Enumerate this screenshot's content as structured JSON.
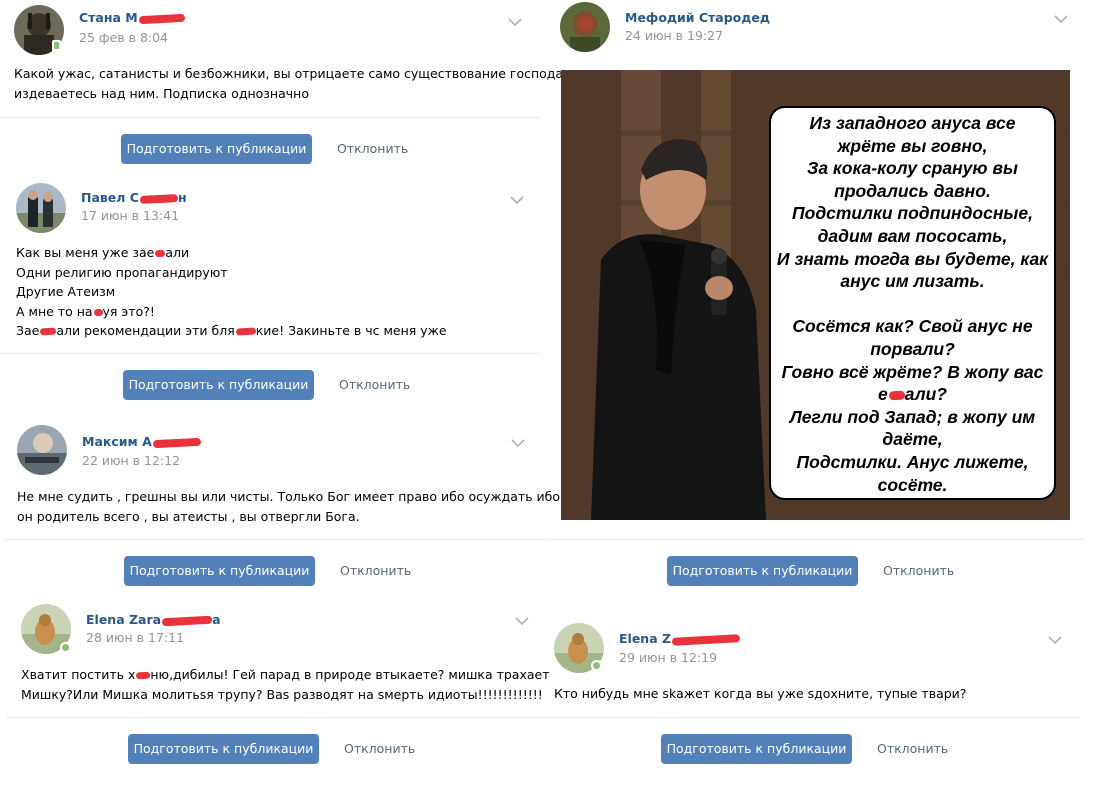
{
  "posts": [
    {
      "author": "Стана М",
      "author_suffix": "",
      "date": "25 фев в 8:04",
      "lines": [
        "Какой ужас, сатанисты и безбожники, вы отрицаете само существование господа,",
        "издеваетесь над ним. Подписка однозначно"
      ]
    },
    {
      "author": "Павел С",
      "author_suffix": "н",
      "date": "17 июн в 13:41",
      "lines": [
        "Как вы меня уже зае|али",
        "Одни религию пропагандируют",
        "Другие Атеизм",
        "А мне то на|уя это?!",
        "Зае|али рекомендации эти бля|кие! Закиньте в чс меня уже"
      ]
    },
    {
      "author": "Максим А",
      "author_suffix": "",
      "date": "22 июн в 12:12",
      "lines": [
        "Не мне судить , грешны вы или чисты. Только Бог имеет право ибо осуждать ибо",
        "он родитель всего , вы атеисты , вы отвергли Бога."
      ]
    },
    {
      "author": "Elena Zara",
      "author_suffix": "a",
      "date": "28 июн в 17:11",
      "lines": [
        "Хватит постить х|ню,дибилы! Гей парад в природе втыкаете? мишка трахает",
        "Мишку?Или Мишка молитьsя трупу? Bas разводят на sмерть идиоты!!!!!!!!!!!!!"
      ]
    },
    {
      "author": "Мефодий Стародед",
      "author_suffix": "",
      "date": "24 июн в 19:27",
      "lines": []
    },
    {
      "author": "Elena Z",
      "author_suffix": "",
      "date": "29 июн в 12:19",
      "lines": [
        "Кто нибудь мне skажет когда вы уже sдохните, тупые твари?"
      ]
    }
  ],
  "meme_text": [
    "Из западного ануса все",
    "жрёте вы говно,",
    "За кока-колу сраную вы",
    "продались давно.",
    "Подстилки подпиндосные,",
    "дадим вам пососать,",
    "И знать тогда вы будете, как",
    "анус им лизать.",
    "",
    "Сосётся как? Свой анус не",
    "порвали?",
    "Говно всё жрёте? В жопу вас",
    "е|али?",
    "Легли под Запад; в жопу им",
    "даёте,",
    "Подстилки. Анус лижете,",
    "сосёте."
  ],
  "actions": {
    "prepare_label": "Подготовить к публикации",
    "reject_label": "Отклонить"
  },
  "colors": {
    "link": "#2a5885",
    "button": "#5181b8",
    "muted": "#939393",
    "redaction": "#e8323c",
    "online": "#8ac176"
  },
  "icons": [
    "chevron-down-icon",
    "online-mobile-icon",
    "online-dot-icon"
  ]
}
